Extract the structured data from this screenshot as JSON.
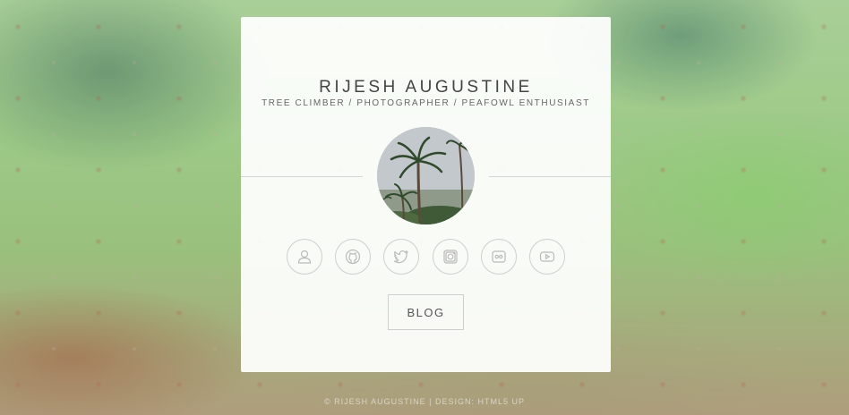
{
  "profile": {
    "name": "RIJESH AUGUSTINE",
    "tagline": "TREE CLIMBER / PHOTOGRAPHER / PEAFOWL ENTHUSIAST"
  },
  "social_links": [
    {
      "icon": "user-icon"
    },
    {
      "icon": "github-icon"
    },
    {
      "icon": "twitter-icon"
    },
    {
      "icon": "instagram-icon"
    },
    {
      "icon": "flickr-icon"
    },
    {
      "icon": "youtube-icon"
    }
  ],
  "blog": {
    "label": "BLOG"
  },
  "footer": {
    "text": "© RIJESH AUGUSTINE | DESIGN: HTML5 UP"
  },
  "colors": {
    "card_background": "#ffffff",
    "text_primary": "#444444",
    "icon_stroke": "#bbbbbb"
  }
}
